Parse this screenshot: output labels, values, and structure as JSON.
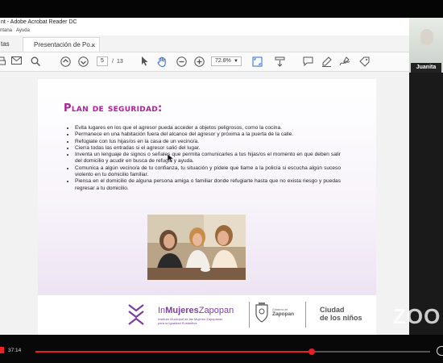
{
  "window": {
    "title": "nt - Adobe Acrobat Reader DC",
    "menu": [
      "ntana",
      "Ayuda"
    ]
  },
  "tabs": [
    {
      "label": "tas"
    },
    {
      "label": "Presentación de Po..."
    }
  ],
  "tab_close_glyph": "×",
  "toolbar": {
    "current_page": "5",
    "page_sep": "/",
    "total_pages": "13",
    "zoom": "72.8%"
  },
  "slide": {
    "title": "Plan de seguridad:",
    "bullets": [
      "Evita lugares en los que el agresor pueda acceder a objetos peligrosos, como la cocina.",
      "Permanece en una habitación fuera del alcance del agresor y próxima a la puerta de la calle.",
      "Refúgiate con tus hijas/os en la casa de un vecino/a.",
      "Cierra todas las entradas si el agresor salió del lugar.",
      "Inventa un lenguaje de signos o señales que permita comunicarles a tus hijas/os el momento en que deben salir del domicilio y acudir en busca de refugio y ayuda.",
      "Comunica a algún vecino/a de tu confianza, tu situación y pídele que llame a la policía si escucha algún suceso violento en tu domicilio familiar.",
      "Piensa en el domicilio de alguna persona amiga o familiar donde refugiarte hasta que no exista riesgo y puedas regresar a tu domicilio."
    ],
    "logo_main_a": "In",
    "logo_main_b": "Mujeres",
    "logo_main_c": "Zapopan",
    "logo_sub_1": "Instituto Municipal de las Mujeres Zapopanas",
    "logo_sub_2": "para la Igualdad Sustantiva",
    "gov_label": "Gobierno de",
    "gov_name": "Zapopan",
    "city_1": "Ciudad",
    "city_2": "de los niños"
  },
  "participant": {
    "name": "Juanita"
  },
  "watermark": "ZOO",
  "video": {
    "time": "37:14",
    "progress": 0.7,
    "accent": "#e22222"
  },
  "colors": {
    "slide_title": "#b0219a",
    "logo_purple": "#7b3fa0"
  }
}
